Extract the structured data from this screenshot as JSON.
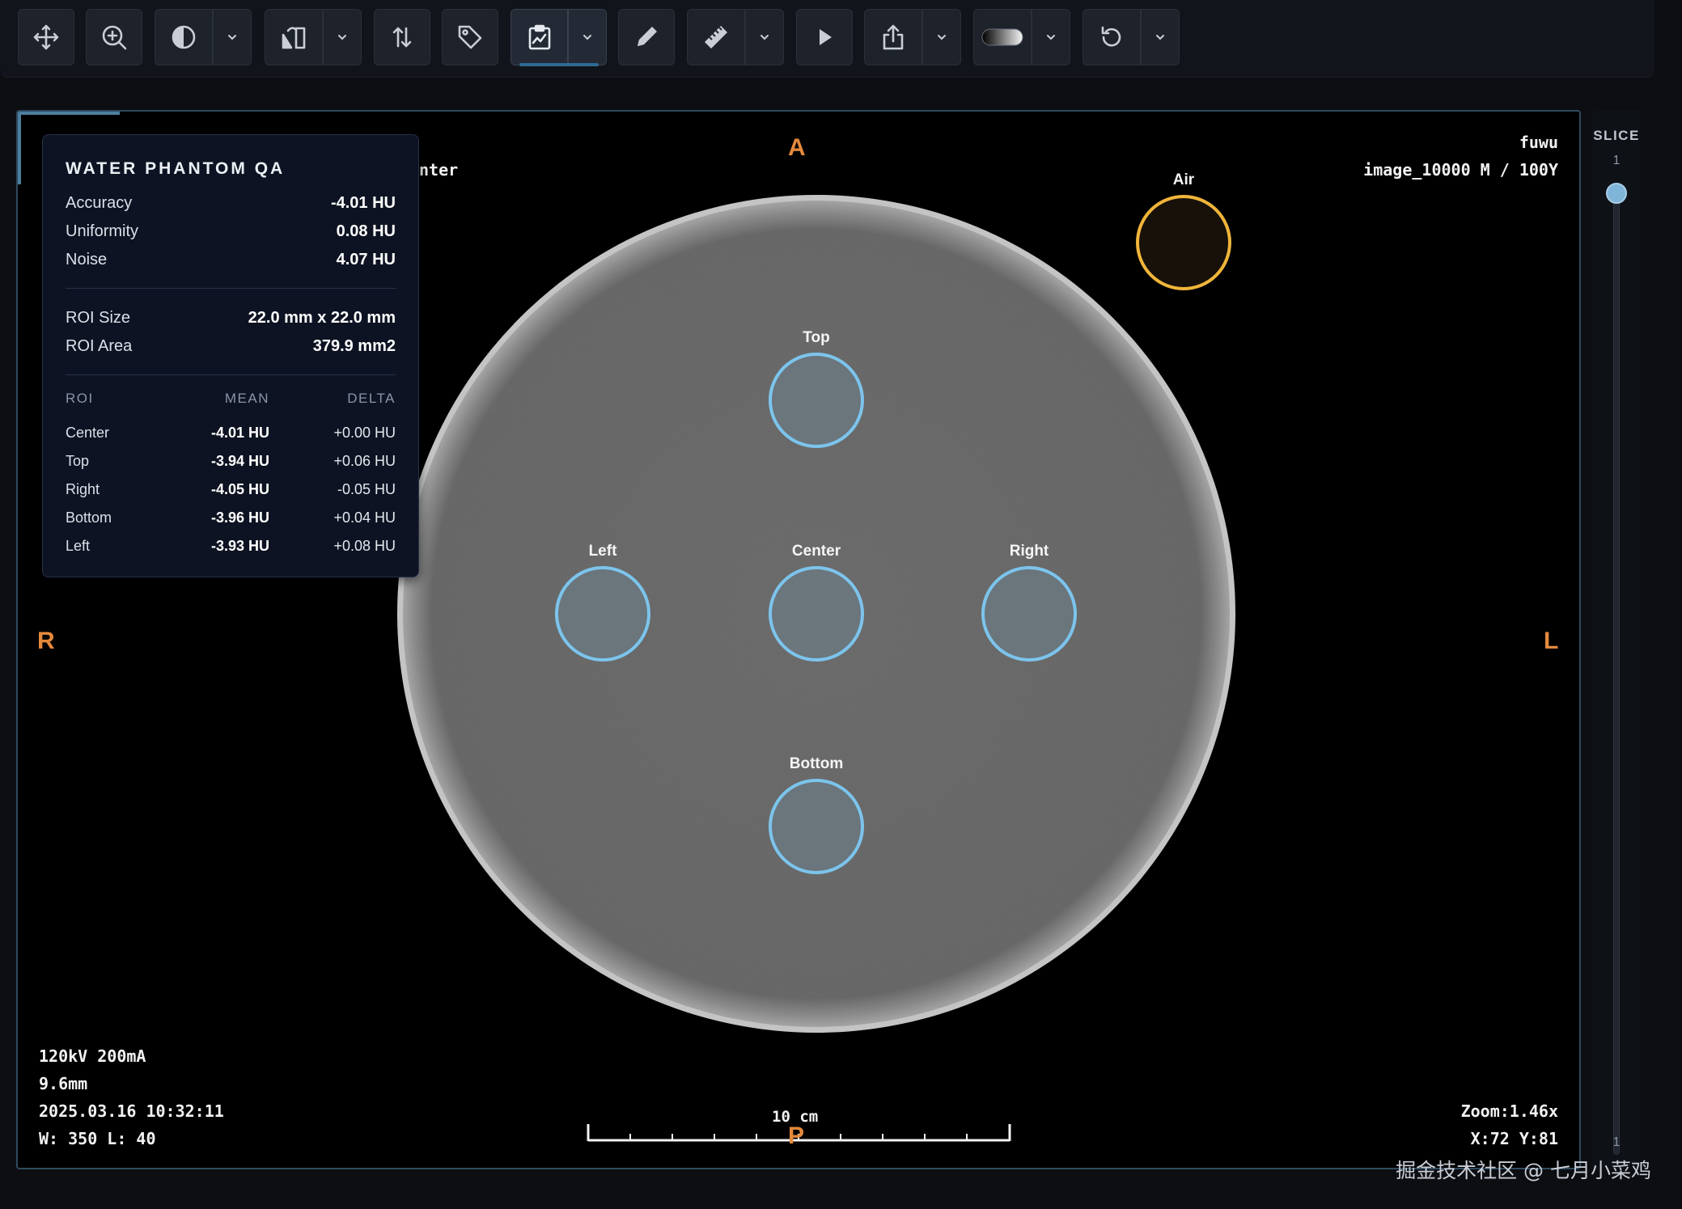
{
  "toolbar": {
    "tools": [
      {
        "name": "pan-tool-button",
        "icon": "pan-icon"
      },
      {
        "name": "zoom-tool-button",
        "icon": "zoom-in-icon"
      },
      {
        "name": "window-level-button",
        "icon": "contrast-icon"
      },
      {
        "name": "flip-rotate-button",
        "icon": "flip-icon"
      },
      {
        "name": "scroll-button",
        "icon": "arrows-up-down-icon"
      },
      {
        "name": "label-button",
        "icon": "tag-icon"
      },
      {
        "name": "qa-report-button",
        "icon": "clipboard-chart-icon",
        "active": true
      },
      {
        "name": "annotate-button",
        "icon": "pencil-icon"
      },
      {
        "name": "measure-button",
        "icon": "ruler-icon"
      },
      {
        "name": "cine-play-button",
        "icon": "play-icon"
      },
      {
        "name": "export-button",
        "icon": "share-icon"
      },
      {
        "name": "colormap-button",
        "icon": "gradient-pill-icon"
      },
      {
        "name": "reset-button",
        "icon": "reset-icon"
      }
    ]
  },
  "viewport": {
    "orientation": {
      "top": "A",
      "bottom": "P",
      "left": "R",
      "right": "L"
    },
    "top_right": {
      "line1": "fuwu",
      "line2": "image_10000 M / 100Y"
    },
    "partial_label": "nter",
    "bottom_left": {
      "line1": "120kV 200mA",
      "line2": "9.6mm",
      "line3": "2025.03.16 10:32:11",
      "line4": "W: 350 L: 40"
    },
    "bottom_right": {
      "zoom": "Zoom:1.46x",
      "coords": "X:72 Y:81"
    },
    "scale_bar_label": "10 cm",
    "rois": {
      "top": "Top",
      "left": "Left",
      "center": "Center",
      "right": "Right",
      "bottom": "Bottom",
      "air": "Air"
    },
    "colors": {
      "roi_water": "#7cc4ec",
      "roi_air": "#f0b53a",
      "orientation": "#e4893c"
    }
  },
  "qa_panel": {
    "title": "WATER PHANTOM QA",
    "metrics": [
      {
        "label": "Accuracy",
        "value": "-4.01 HU"
      },
      {
        "label": "Uniformity",
        "value": "0.08 HU"
      },
      {
        "label": "Noise",
        "value": "4.07 HU"
      }
    ],
    "roi_info": [
      {
        "label": "ROI Size",
        "value": "22.0 mm x 22.0 mm"
      },
      {
        "label": "ROI Area",
        "value": "379.9 mm2"
      }
    ],
    "table": {
      "headers": [
        "ROI",
        "MEAN",
        "DELTA"
      ],
      "rows": [
        [
          "Center",
          "-4.01 HU",
          "+0.00 HU"
        ],
        [
          "Top",
          "-3.94 HU",
          "+0.06 HU"
        ],
        [
          "Right",
          "-4.05 HU",
          "-0.05 HU"
        ],
        [
          "Bottom",
          "-3.96 HU",
          "+0.04 HU"
        ],
        [
          "Left",
          "-3.93 HU",
          "+0.08 HU"
        ]
      ]
    }
  },
  "slice": {
    "label": "SLICE",
    "top_value": "1",
    "bottom_value": "1",
    "position": 0.0
  },
  "watermark": "掘金技术社区 @ 七月小菜鸡"
}
